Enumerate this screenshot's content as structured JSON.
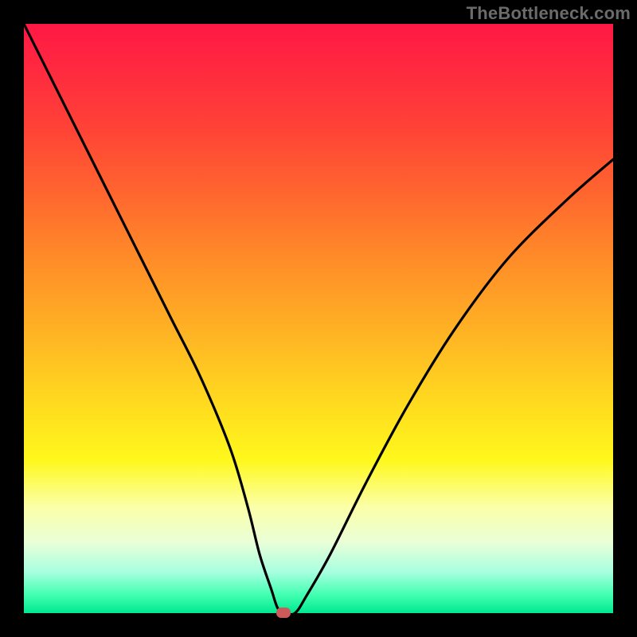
{
  "watermark": {
    "text": "TheBottleneck.com"
  },
  "colors": {
    "frame": "#000000",
    "gradient_top": "#ff1845",
    "gradient_mid": "#ffe41c",
    "gradient_bottom": "#00e890",
    "curve": "#000000",
    "marker": "#cc5a5a"
  },
  "chart_data": {
    "type": "line",
    "title": "",
    "xlabel": "",
    "ylabel": "",
    "xlim": [
      0,
      100
    ],
    "ylim": [
      0,
      100
    ],
    "series": [
      {
        "name": "bottleneck-curve",
        "x": [
          0,
          5,
          10,
          15,
          20,
          25,
          30,
          35,
          38,
          40,
          42,
          43,
          44,
          46,
          48,
          52,
          58,
          65,
          73,
          82,
          92,
          100
        ],
        "y": [
          100,
          90,
          80,
          70,
          60,
          50,
          40,
          28,
          18,
          10,
          4,
          1,
          0,
          0,
          3,
          10,
          22,
          35,
          48,
          60,
          70,
          77
        ]
      }
    ],
    "marker": {
      "x": 44,
      "y": 0
    },
    "grid": false,
    "legend_position": "none"
  }
}
